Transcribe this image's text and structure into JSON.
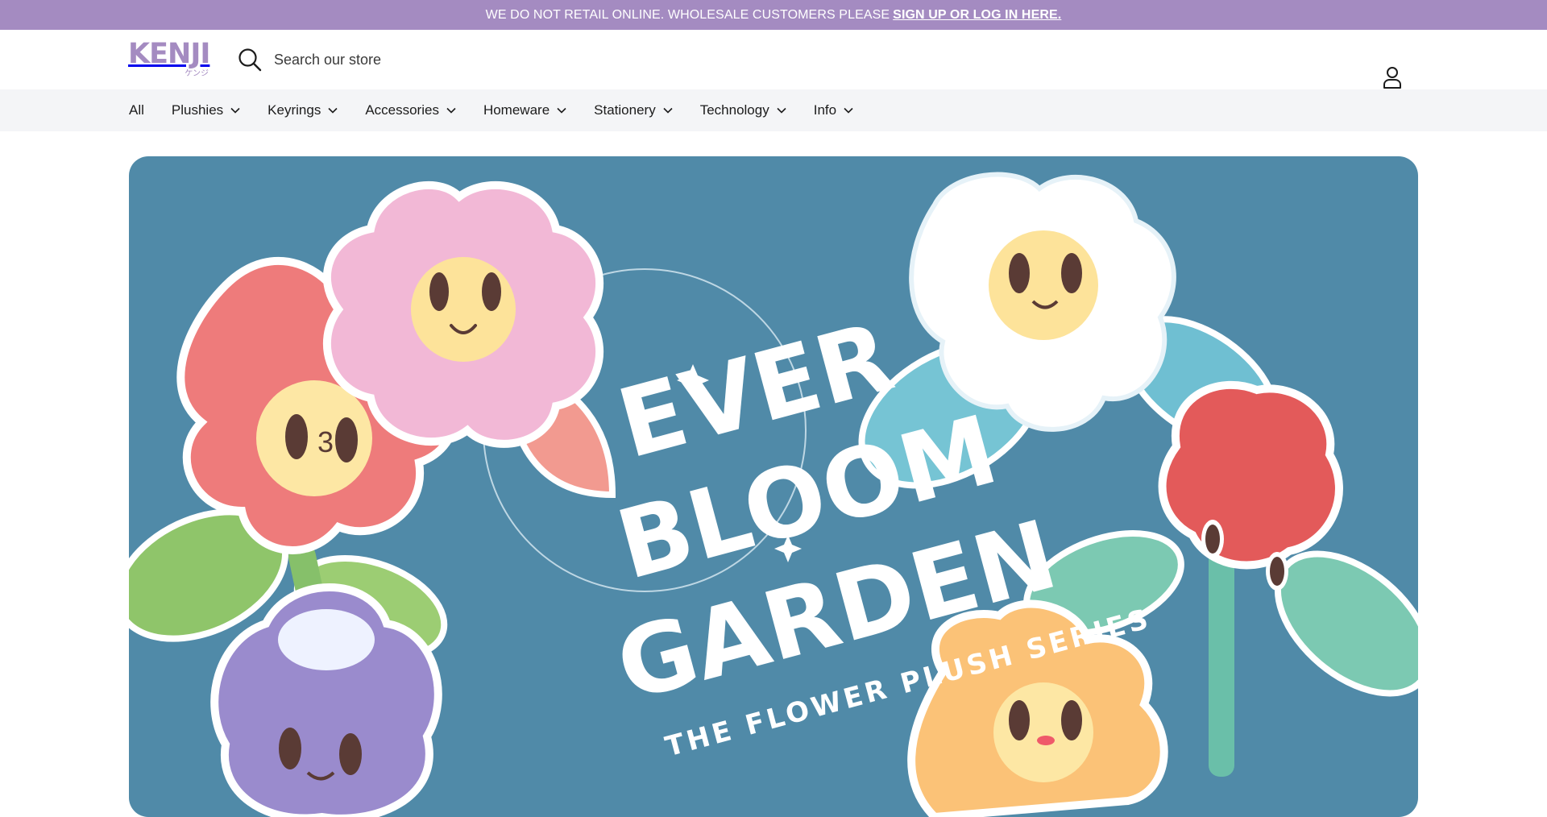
{
  "announcement": {
    "text": "WE DO NOT RETAIL ONLINE. WHOLESALE CUSTOMERS PLEASE",
    "link": "SIGN UP OR LOG IN HERE."
  },
  "header": {
    "logo_word": "KENJI",
    "logo_sub": "ケンジ",
    "search_placeholder": "Search our store"
  },
  "nav": {
    "items": [
      {
        "label": "All"
      },
      {
        "label": "Plushies"
      },
      {
        "label": "Keyrings"
      },
      {
        "label": "Accessories"
      },
      {
        "label": "Homeware"
      },
      {
        "label": "Stationery"
      },
      {
        "label": "Technology"
      },
      {
        "label": "Info"
      }
    ]
  },
  "hero": {
    "line1": "EVER",
    "line2": "BLOOM",
    "line3": "GARDEN",
    "subtitle": "THE FLOWER PLUSH SERIES",
    "background": "#508aa8"
  },
  "colors": {
    "brand": "#a48bc1",
    "nav_bg": "#f4f5f7"
  }
}
